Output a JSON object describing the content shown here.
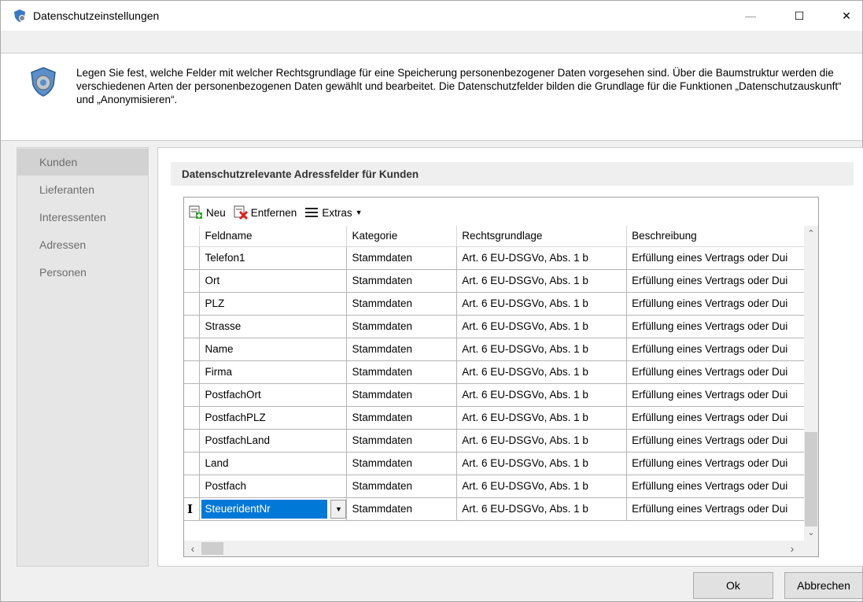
{
  "window": {
    "title": "Datenschutzeinstellungen",
    "controls": {
      "minimize": "—",
      "maximize": "☐",
      "close": "✕"
    }
  },
  "info": {
    "text": "Legen Sie fest, welche Felder mit welcher Rechtsgrundlage für eine Speicherung personenbezogener Daten vorgesehen sind. Über die Baumstruktur werden die verschiedenen Arten der personenbezogenen Daten gewählt und bearbeitet. Die Datenschutzfelder bilden die Grundlage für die Funktionen „Datenschutzauskunft“ und „Anonymisieren“."
  },
  "sidebar": {
    "items": [
      {
        "label": "Kunden"
      },
      {
        "label": "Lieferanten"
      },
      {
        "label": "Interessenten"
      },
      {
        "label": "Adressen"
      },
      {
        "label": "Personen"
      }
    ]
  },
  "group": {
    "title": "Datenschutzrelevante Adressfelder für Kunden"
  },
  "toolbar": {
    "new_label": "Neu",
    "remove_label": "Entfernen",
    "extras_label": "Extras"
  },
  "grid": {
    "columns": [
      "Feldname",
      "Kategorie",
      "Rechtsgrundlage",
      "Beschreibung"
    ],
    "rows": [
      [
        "Telefon1",
        "Stammdaten",
        "Art. 6 EU-DSGVo, Abs. 1 b",
        "Erfüllung eines Vertrags oder Dui"
      ],
      [
        "Ort",
        "Stammdaten",
        "Art. 6 EU-DSGVo, Abs. 1 b",
        "Erfüllung eines Vertrags oder Dui"
      ],
      [
        "PLZ",
        "Stammdaten",
        "Art. 6 EU-DSGVo, Abs. 1 b",
        "Erfüllung eines Vertrags oder Dui"
      ],
      [
        "Strasse",
        "Stammdaten",
        "Art. 6 EU-DSGVo, Abs. 1 b",
        "Erfüllung eines Vertrags oder Dui"
      ],
      [
        "Name",
        "Stammdaten",
        "Art. 6 EU-DSGVo, Abs. 1 b",
        "Erfüllung eines Vertrags oder Dui"
      ],
      [
        "Firma",
        "Stammdaten",
        "Art. 6 EU-DSGVo, Abs. 1 b",
        "Erfüllung eines Vertrags oder Dui"
      ],
      [
        "PostfachOrt",
        "Stammdaten",
        "Art. 6 EU-DSGVo, Abs. 1 b",
        "Erfüllung eines Vertrags oder Dui"
      ],
      [
        "PostfachPLZ",
        "Stammdaten",
        "Art. 6 EU-DSGVo, Abs. 1 b",
        "Erfüllung eines Vertrags oder Dui"
      ],
      [
        "PostfachLand",
        "Stammdaten",
        "Art. 6 EU-DSGVo, Abs. 1 b",
        "Erfüllung eines Vertrags oder Dui"
      ],
      [
        "Land",
        "Stammdaten",
        "Art. 6 EU-DSGVo, Abs. 1 b",
        "Erfüllung eines Vertrags oder Dui"
      ],
      [
        "Postfach",
        "Stammdaten",
        "Art. 6 EU-DSGVo, Abs. 1 b",
        "Erfüllung eines Vertrags oder Dui"
      ]
    ],
    "editing_row": {
      "indicator": "I",
      "field": "SteueridentNr",
      "category": "Stammdaten",
      "legal_basis": "Art. 6 EU-DSGVo, Abs. 1 b",
      "description": "Erfüllung eines Vertrags oder Dui"
    }
  },
  "buttons": {
    "ok": "Ok",
    "cancel": "Abbrechen"
  }
}
